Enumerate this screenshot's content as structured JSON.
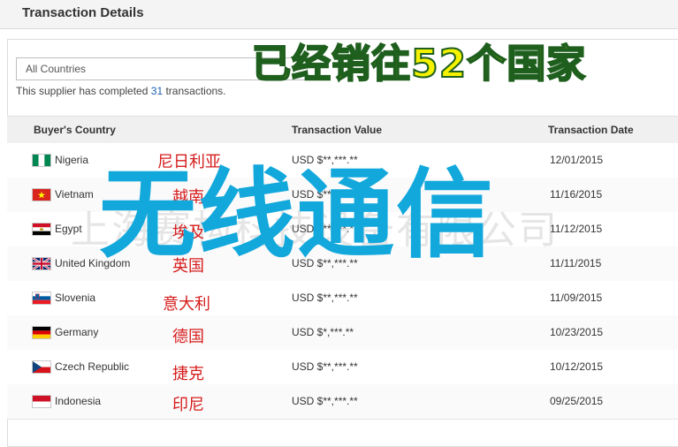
{
  "header": {
    "title": "Transaction Details"
  },
  "filter": {
    "selected": "All Countries"
  },
  "summary": {
    "prefix": "This supplier has completed",
    "count": "31",
    "suffix": "transactions."
  },
  "table": {
    "columns": [
      "Buyer's Country",
      "Transaction Value",
      "Transaction Date"
    ],
    "rows": [
      {
        "country": "Nigeria",
        "value": "USD $**,***.**",
        "date": "12/01/2015",
        "flag": "nigeria-flag-icon",
        "cn": "尼日利亚"
      },
      {
        "country": "Vietnam",
        "value": "USD $**,***.**",
        "date": "11/16/2015",
        "flag": "vietnam-flag-icon",
        "cn": "越南"
      },
      {
        "country": "Egypt",
        "value": "USD $**,***.**",
        "date": "11/12/2015",
        "flag": "egypt-flag-icon",
        "cn": "埃及"
      },
      {
        "country": "United Kingdom",
        "value": "USD $**,***.**",
        "date": "11/11/2015",
        "flag": "uk-flag-icon",
        "cn": "英国"
      },
      {
        "country": "Slovenia",
        "value": "USD $**,***.**",
        "date": "11/09/2015",
        "flag": "slovenia-flag-icon",
        "cn": "意大利"
      },
      {
        "country": "Germany",
        "value": "USD $*,***.**",
        "date": "10/23/2015",
        "flag": "germany-flag-icon",
        "cn": "德国"
      },
      {
        "country": "Czech Republic",
        "value": "USD $**,***.**",
        "date": "10/12/2015",
        "flag": "czech-flag-icon",
        "cn": "捷克"
      },
      {
        "country": "Indonesia",
        "value": "USD $**,***.**",
        "date": "09/25/2015",
        "flag": "indonesia-flag-icon",
        "cn": "印尼"
      }
    ]
  },
  "overlays": {
    "banner": "已经销往52个国家",
    "big_text": "无线通信",
    "watermark": "上海赛构科技设备有限公司"
  },
  "colors": {
    "cn_label": "#d61c1c",
    "banner_fill": "#f5f200",
    "big_text": "#12a8dc",
    "link": "#1a5fb4"
  }
}
